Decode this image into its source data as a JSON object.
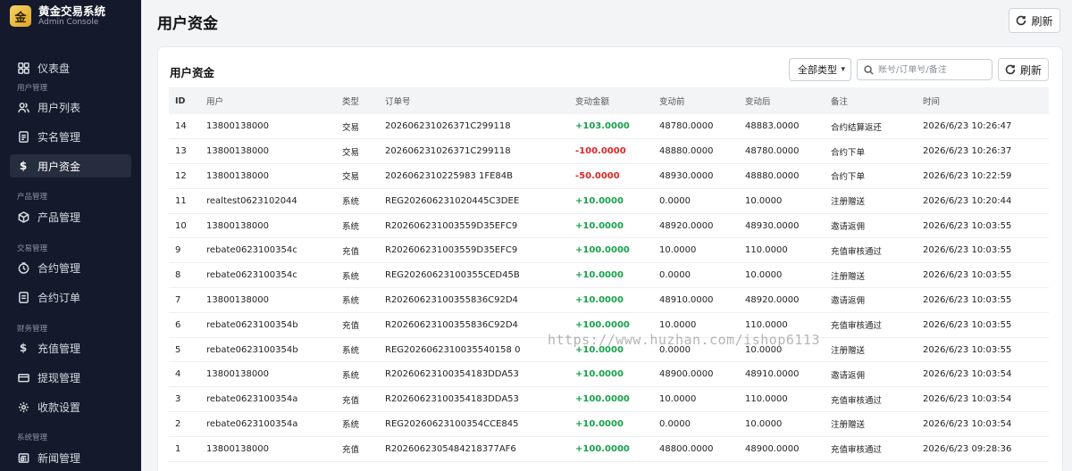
{
  "brand": {
    "logo_text": "金",
    "title": "黄金交易系统",
    "subtitle": "Admin Console"
  },
  "sidebar": {
    "dashboard": {
      "label": "仪表盘",
      "icon": "grid-icon"
    },
    "sections": {
      "user_mgmt": "用户管理",
      "product_mgmt": "产品管理",
      "trade_mgmt": "交易管理",
      "finance_mgmt": "财务管理",
      "system_mgmt": "系统管理"
    },
    "items": {
      "user_list": {
        "label": "用户列表",
        "icon": "users-icon"
      },
      "kyc": {
        "label": "实名管理",
        "icon": "id-card-icon"
      },
      "user_funds": {
        "label": "用户资金",
        "icon": "dollar-icon"
      },
      "products": {
        "label": "产品管理",
        "icon": "box-icon"
      },
      "contracts": {
        "label": "合约管理",
        "icon": "clock-icon"
      },
      "contract_orders": {
        "label": "合约订单",
        "icon": "document-icon"
      },
      "recharge": {
        "label": "充值管理",
        "icon": "dollar-icon"
      },
      "withdraw": {
        "label": "提现管理",
        "icon": "card-icon"
      },
      "payment_settings": {
        "label": "收款设置",
        "icon": "gear-icon"
      },
      "news": {
        "label": "新闻管理",
        "icon": "news-icon"
      }
    },
    "active_color": "#262d3e"
  },
  "header": {
    "title": "用户资金",
    "refresh_label": "刷新"
  },
  "card": {
    "title": "用户资金",
    "filter_selected": "全部类型",
    "search_placeholder": "账号/订单号/备注",
    "refresh_label": "刷新"
  },
  "table": {
    "columns": [
      "ID",
      "用户",
      "类型",
      "订单号",
      "变动金额",
      "变动前",
      "变动后",
      "备注",
      "时间"
    ],
    "rows": [
      [
        "14",
        "13800138000",
        "交易",
        "202606231026371C299118",
        "+103.0000",
        "48780.0000",
        "48883.0000",
        "合约结算返还",
        "2026/6/23 10:26:47"
      ],
      [
        "13",
        "13800138000",
        "交易",
        "202606231026371C299118",
        "-100.0000",
        "48880.0000",
        "48780.0000",
        "合约下单",
        "2026/6/23 10:26:37"
      ],
      [
        "12",
        "13800138000",
        "交易",
        "2026062310225983 1FE84B",
        "-50.0000",
        "48930.0000",
        "48880.0000",
        "合约下单",
        "2026/6/23 10:22:59"
      ],
      [
        "11",
        "realtest0623102044",
        "系统",
        "REG202606231020445C3DEE",
        "+10.0000",
        "0.0000",
        "10.0000",
        "注册赠送",
        "2026/6/23 10:20:44"
      ],
      [
        "10",
        "13800138000",
        "系统",
        "R202606231003559D35EFC9",
        "+10.0000",
        "48920.0000",
        "48930.0000",
        "邀请返佣",
        "2026/6/23 10:03:55"
      ],
      [
        "9",
        "rebate0623100354c",
        "充值",
        "R202606231003559D35EFC9",
        "+100.0000",
        "10.0000",
        "110.0000",
        "充值审核通过",
        "2026/6/23 10:03:55"
      ],
      [
        "8",
        "rebate0623100354c",
        "系统",
        "REG20260623100355CED45B",
        "+10.0000",
        "0.0000",
        "10.0000",
        "注册赠送",
        "2026/6/23 10:03:55"
      ],
      [
        "7",
        "13800138000",
        "系统",
        "R20260623100355836C92D4",
        "+10.0000",
        "48910.0000",
        "48920.0000",
        "邀请返佣",
        "2026/6/23 10:03:55"
      ],
      [
        "6",
        "rebate0623100354b",
        "充值",
        "R20260623100355836C92D4",
        "+100.0000",
        "10.0000",
        "110.0000",
        "充值审核通过",
        "2026/6/23 10:03:55"
      ],
      [
        "5",
        "rebate0623100354b",
        "系统",
        "REG2026062310035540158 0",
        "+10.0000",
        "0.0000",
        "10.0000",
        "注册赠送",
        "2026/6/23 10:03:55"
      ],
      [
        "4",
        "13800138000",
        "系统",
        "R20260623100354183DDA53",
        "+10.0000",
        "48900.0000",
        "48910.0000",
        "邀请返佣",
        "2026/6/23 10:03:54"
      ],
      [
        "3",
        "rebate0623100354a",
        "充值",
        "R20260623100354183DDA53",
        "+100.0000",
        "10.0000",
        "110.0000",
        "充值审核通过",
        "2026/6/23 10:03:54"
      ],
      [
        "2",
        "rebate0623100354a",
        "系统",
        "REG20260623100354CCE845",
        "+10.0000",
        "0.0000",
        "10.0000",
        "注册赠送",
        "2026/6/23 10:03:54"
      ],
      [
        "1",
        "13800138000",
        "充值",
        "R2026062305484218377AF6",
        "+100.0000",
        "48800.0000",
        "48900.0000",
        "充值审核通过",
        "2026/6/23 09:28:36"
      ]
    ],
    "positive_color": "#16a34a",
    "negative_color": "#dc2626"
  },
  "watermark": "https://www.huzhan.com/ishop6113"
}
